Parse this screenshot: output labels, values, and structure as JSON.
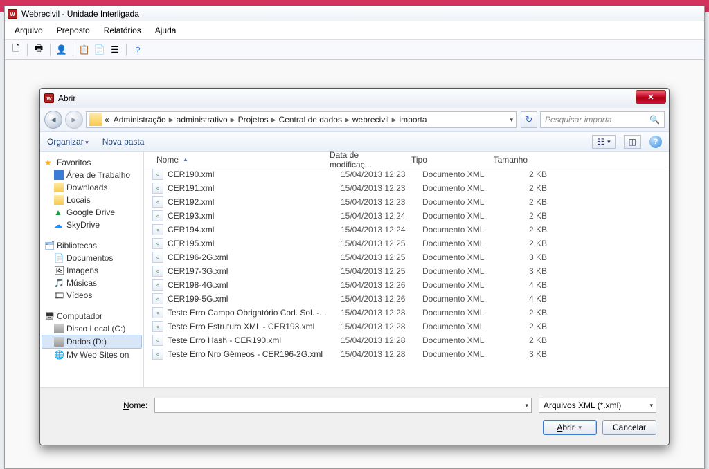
{
  "appWindow": {
    "title": "Webrecivil - Unidade Interligada",
    "menu": [
      "Arquivo",
      "Preposto",
      "Relatórios",
      "Ajuda"
    ]
  },
  "dialog": {
    "title": "Abrir",
    "breadcrumb": {
      "prefix": "«",
      "segs": [
        "Administração",
        "administrativo",
        "Projetos",
        "Central de dados",
        "webrecivil",
        "importa"
      ]
    },
    "search": {
      "placeholder": "Pesquisar importa"
    },
    "cmd": {
      "organize": "Organizar",
      "newFolder": "Nova pasta"
    },
    "side": {
      "fav": {
        "label": "Favoritos",
        "items": [
          "Área de Trabalho",
          "Downloads",
          "Locais",
          "Google Drive",
          "SkyDrive"
        ]
      },
      "lib": {
        "label": "Bibliotecas",
        "items": [
          "Documentos",
          "Imagens",
          "Músicas",
          "Vídeos"
        ]
      },
      "comp": {
        "label": "Computador",
        "items": [
          "Disco Local (C:)",
          "Dados (D:)",
          "Mv Web Sites on"
        ]
      }
    },
    "cols": {
      "name": "Nome",
      "date": "Data de modificaç...",
      "type": "Tipo",
      "size": "Tamanho"
    },
    "rows": [
      {
        "n": "CER190.xml",
        "d": "15/04/2013 12:23",
        "t": "Documento XML",
        "s": "2 KB"
      },
      {
        "n": "CER191.xml",
        "d": "15/04/2013 12:23",
        "t": "Documento XML",
        "s": "2 KB"
      },
      {
        "n": "CER192.xml",
        "d": "15/04/2013 12:23",
        "t": "Documento XML",
        "s": "2 KB"
      },
      {
        "n": "CER193.xml",
        "d": "15/04/2013 12:24",
        "t": "Documento XML",
        "s": "2 KB"
      },
      {
        "n": "CER194.xml",
        "d": "15/04/2013 12:24",
        "t": "Documento XML",
        "s": "2 KB"
      },
      {
        "n": "CER195.xml",
        "d": "15/04/2013 12:25",
        "t": "Documento XML",
        "s": "2 KB"
      },
      {
        "n": "CER196-2G.xml",
        "d": "15/04/2013 12:25",
        "t": "Documento XML",
        "s": "3 KB"
      },
      {
        "n": "CER197-3G.xml",
        "d": "15/04/2013 12:25",
        "t": "Documento XML",
        "s": "3 KB"
      },
      {
        "n": "CER198-4G.xml",
        "d": "15/04/2013 12:26",
        "t": "Documento XML",
        "s": "4 KB"
      },
      {
        "n": "CER199-5G.xml",
        "d": "15/04/2013 12:26",
        "t": "Documento XML",
        "s": "4 KB"
      },
      {
        "n": "Teste Erro Campo Obrigatório Cod. Sol. -...",
        "d": "15/04/2013 12:28",
        "t": "Documento XML",
        "s": "2 KB"
      },
      {
        "n": "Teste Erro Estrutura XML - CER193.xml",
        "d": "15/04/2013 12:28",
        "t": "Documento XML",
        "s": "2 KB"
      },
      {
        "n": "Teste Erro Hash - CER190.xml",
        "d": "15/04/2013 12:28",
        "t": "Documento XML",
        "s": "2 KB"
      },
      {
        "n": "Teste Erro Nro Gêmeos - CER196-2G.xml",
        "d": "15/04/2013 12:28",
        "t": "Documento XML",
        "s": "3 KB"
      }
    ],
    "footer": {
      "nameLabel": "Nome:",
      "nameLabelU": "N",
      "fileType": "Arquivos XML (*.xml)",
      "open": "Abrir",
      "openU": "A",
      "cancel": "Cancelar"
    }
  }
}
